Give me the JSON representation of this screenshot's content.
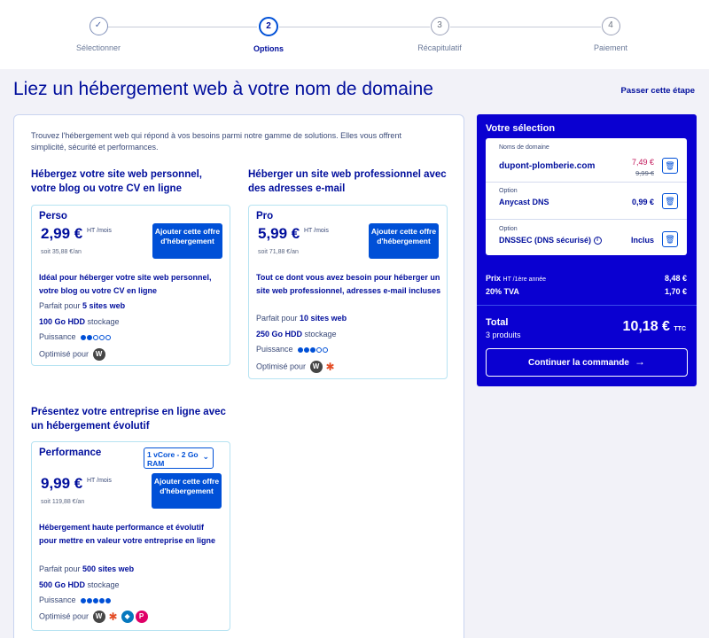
{
  "stepper": {
    "steps": [
      {
        "num": "✓",
        "label": "Sélectionner"
      },
      {
        "num": "2",
        "label": "Options"
      },
      {
        "num": "3",
        "label": "Récapitulatif"
      },
      {
        "num": "4",
        "label": "Paiement"
      }
    ]
  },
  "header": {
    "title": "Liez un hébergement web à votre nom de domaine",
    "skip": "Passer cette étape"
  },
  "main": {
    "intro": "Trouvez l'hébergement web qui répond à vos besoins parmi notre gamme de solutions. Elles vous offrent simplicité, sécurité et performances.",
    "sections": [
      {
        "heading": "Hébergez votre site web personnel, votre blog ou votre CV en ligne",
        "offer": {
          "name": "Perso",
          "price": "2,99 €",
          "price_unit": "HT /mois",
          "yearly": "soit 35,88 €/an",
          "button": "Ajouter cette offre d'hébergement",
          "description": "Idéal pour héberger votre site web personnel, votre blog ou votre CV en ligne",
          "sites_prefix": "Parfait pour",
          "sites": "5 sites web",
          "storage": "100 Go HDD",
          "storage_suffix": "stockage",
          "power_label": "Puissance",
          "power": 2,
          "optimized_label": "Optimisé pour"
        }
      },
      {
        "heading": "Héberger un site web professionnel avec des adresses e-mail",
        "offer": {
          "name": "Pro",
          "price": "5,99 €",
          "price_unit": "HT /mois",
          "yearly": "soit 71,88 €/an",
          "button": "Ajouter cette offre d'hébergement",
          "description": "Tout ce dont vous avez besoin pour héberger un site web professionnel, adresses e-mail incluses",
          "sites_prefix": "Parfait pour",
          "sites": "10 sites web",
          "storage": "250 Go HDD",
          "storage_suffix": "stockage",
          "power_label": "Puissance",
          "power": 3,
          "optimized_label": "Optimisé pour"
        }
      },
      {
        "heading": "Présentez votre entreprise en ligne avec un hébergement évolutif",
        "offer": {
          "name": "Performance",
          "select": "1 vCore - 2 Go RAM",
          "price": "9,99 €",
          "price_unit": "HT /mois",
          "yearly": "soit 119,88 €/an",
          "button": "Ajouter cette offre d'hébergement",
          "description": "Hébergement haute performance et évolutif pour mettre en valeur votre entreprise en ligne",
          "sites_prefix": "Parfait pour",
          "sites": "500 sites web",
          "storage": "500 Go HDD",
          "storage_suffix": "stockage",
          "power_label": "Puissance",
          "power": 5,
          "optimized_label": "Optimisé pour"
        }
      }
    ]
  },
  "sidebar": {
    "title": "Votre sélection",
    "items": [
      {
        "kind": "Noms de domaine",
        "name": "dupont-plomberie.com",
        "price": "7,49 €",
        "old_price": "9,99 €"
      },
      {
        "kind": "Option",
        "name": "Anycast DNS",
        "price": "0,99 €"
      },
      {
        "kind": "Option",
        "name": "DNSSEC (DNS sécurisé)",
        "price": "Inclus"
      }
    ],
    "price_label": "Prix",
    "price_label_small": "HT /1ère année",
    "price_value": "8,48 €",
    "tva_label": "20% TVA",
    "tva_value": "1,70 €",
    "total_label": "Total",
    "total_sub": "3 produits",
    "total_value": "10,18 €",
    "total_suffix": "TTC",
    "continue": "Continuer la commande"
  },
  "colors": {
    "accent": "#0050d7",
    "navy": "#000e9c",
    "sidebar": "#0a00d1",
    "discount": "#c2185b"
  }
}
